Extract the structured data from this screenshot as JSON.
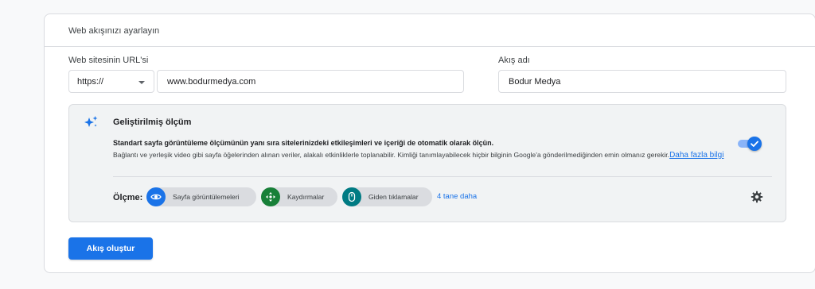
{
  "card": {
    "title": "Web akışınızı ayarlayın"
  },
  "form": {
    "url_label": "Web sitesinin URL'si",
    "protocol_selected": "https://",
    "url_value": "www.bodurmedya.com",
    "name_label": "Akış adı",
    "name_value": "Bodur Medya"
  },
  "enhanced": {
    "icon": "sparkle-icon",
    "title": "Geliştirilmiş ölçüm",
    "description_main": "Standart sayfa görüntüleme ölçümünün yanı sıra sitelerinizdeki etkileşimleri ve içeriği de otomatik olarak ölçün.",
    "description_sub": "Bağlantı ve yerleşik video gibi sayfa öğelerinden alınan veriler, alakalı etkinliklerle toplanabilir. Kimliği tanımlayabilecek hiçbir bilginin Google'a gönderilmediğinden emin olmanız gerekir.",
    "learn_more": "Daha fazla bilgi",
    "toggle_on": true,
    "measure_label": "Ölçme:",
    "chips": [
      {
        "label": "Sayfa görüntülemeleri",
        "icon": "eye-icon",
        "color": "#1a73e8"
      },
      {
        "label": "Kaydırmalar",
        "icon": "scroll-arrows-icon",
        "color": "#188038"
      },
      {
        "label": "Giden tıklamalar",
        "icon": "mouse-icon",
        "color": "#007b83"
      }
    ],
    "more_link": "4 tane daha",
    "settings_icon": "gear-icon"
  },
  "actions": {
    "create_label": "Akış oluştur"
  },
  "colors": {
    "accent": "#1a73e8",
    "panel_bg": "#f1f3f4",
    "border": "#dadce0"
  }
}
